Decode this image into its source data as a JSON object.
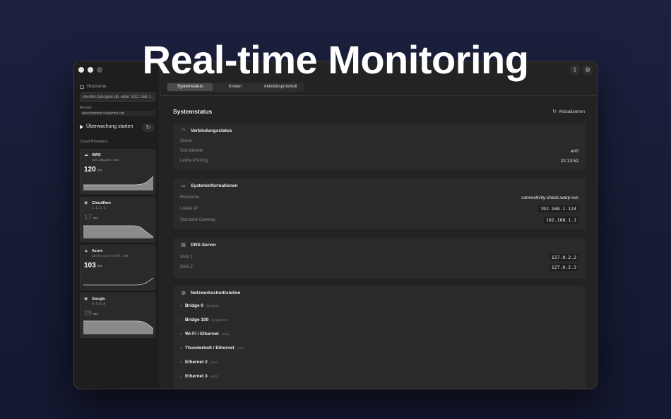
{
  "headline": "Real-time Monitoring",
  "sidebar": {
    "hostname_label": "Hostname",
    "hostname_placeholder": "cluster.beispiel.de oder 192.168.1.",
    "recent_label": "Recent:",
    "recent_item": "development.clusterme.lab",
    "start_monitoring_label": "Überwachung starten",
    "providers_label": "Cloud Providers",
    "providers": [
      {
        "name": "AWS",
        "host": "aws.amazon.com",
        "value": "120",
        "unit": "ms",
        "dim": false
      },
      {
        "name": "Cloudflare",
        "host": "1.1.1.1",
        "value": "17",
        "unit": "ms",
        "dim": true
      },
      {
        "name": "Azure",
        "host": "azure.microsoft.com",
        "value": "103",
        "unit": "ms",
        "dim": false
      },
      {
        "name": "Google",
        "host": "8.8.8.8",
        "value": "29",
        "unit": "ms",
        "dim": true
      }
    ]
  },
  "main": {
    "window_title": "",
    "tabs": [
      "Systemstatus",
      "Knoten",
      "Aktivitätsprotokoll"
    ],
    "active_tab": 0,
    "section_title": "Systemstatus",
    "reload_label": "Aktualisieren",
    "connection": {
      "title": "Verbindungsstatus",
      "rows": [
        {
          "key": "Status",
          "value": "",
          "dim": true
        },
        {
          "key": "Schnittstelle",
          "value": "en0"
        },
        {
          "key": "Letzte Prüfung",
          "value": "22:13:52"
        }
      ]
    },
    "system_info": {
      "title": "Systeminformationen",
      "rows": [
        {
          "key": "Hostname",
          "value": "connectivity-check.warp-svc"
        },
        {
          "key": "Lokale IP",
          "value": "192.168.1.124"
        },
        {
          "key": "Standard-Gateway",
          "value": "192.168.1.1"
        }
      ]
    },
    "dns": {
      "title": "DNS-Server",
      "rows": [
        {
          "key": "DNS 1:",
          "value": "127.0.2.2"
        },
        {
          "key": "DNS 2:",
          "value": "127.0.2.3"
        }
      ]
    },
    "interfaces": {
      "title": "Netzwerkschnittstellen",
      "items": [
        {
          "name": "Bridge 0",
          "dev": "(bridge0)"
        },
        {
          "name": "Bridge 100",
          "dev": "(bridge100)"
        },
        {
          "name": "Wi-Fi / Ethernet",
          "dev": "(en0)"
        },
        {
          "name": "Thunderbolt / Ethernet",
          "dev": "(en1)"
        },
        {
          "name": "Ethernet 2",
          "dev": "(en2)"
        },
        {
          "name": "Ethernet 3",
          "dev": "(en3)"
        }
      ]
    }
  },
  "colors": {
    "background": "#1c2140",
    "window": "#232323",
    "panel": "#2a2a2a",
    "sparkline_fill": "#8a8a8a"
  }
}
